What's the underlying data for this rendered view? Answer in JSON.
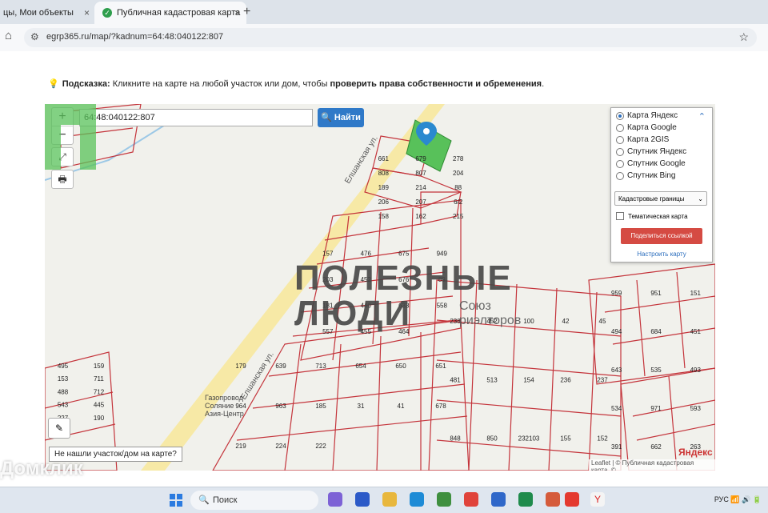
{
  "browser": {
    "tabs": [
      {
        "label": "цы, Мои объекты",
        "close": "×"
      },
      {
        "label": "Публичная кадастровая карта",
        "close": "×"
      }
    ],
    "new_tab": "+",
    "url": "egrp365.ru/map/?kadnum=64:48:040122:807"
  },
  "hint": {
    "prefix": "Подсказка:",
    "text": "Кликните на карте на любой участок или дом, чтобы",
    "bold": "проверить права собственности и обременения",
    "suffix": "."
  },
  "map": {
    "search_value": "64:48:040122:807",
    "find_label": "Найти",
    "zoom_in": "+",
    "zoom_out": "−",
    "layers": [
      {
        "label": "Карта Яндекс",
        "selected": true
      },
      {
        "label": "Карта Google",
        "selected": false
      },
      {
        "label": "Карта 2GIS",
        "selected": false
      },
      {
        "label": "Спутник Яндекс",
        "selected": false
      },
      {
        "label": "Спутник Google",
        "selected": false
      },
      {
        "label": "Спутник Bing",
        "selected": false
      }
    ],
    "layer_select": "Кадастровые границы",
    "thematic_label": "Тематическая карта",
    "share_label": "Поделиться ссылкой",
    "setup_label": "Настроить карту",
    "not_found": "Не нашли участок/дом на карте?",
    "yandex": "Яндекс",
    "attribution": "Leaflet | © Публичная кадастровая карта, ©",
    "street1": "Елшанская ул.",
    "street2": "Елшанская ул.",
    "gas_label1": "Газопровод",
    "gas_label2": "Соляние",
    "gas_label3": "Азия-Центр",
    "parcels": [
      "661",
      "679",
      "278",
      "808",
      "807",
      "204",
      "189",
      "214",
      "88",
      "206",
      "207",
      "6/2",
      "158",
      "162",
      "215",
      "157",
      "476",
      "675",
      "949",
      "203",
      "452",
      "676",
      "89",
      "181",
      "440",
      "633",
      "558",
      "557",
      "455",
      "464",
      "179",
      "639",
      "713",
      "654",
      "650",
      "651",
      "964",
      "963",
      "185",
      "31",
      "41",
      "678",
      "219",
      "224",
      "222",
      "238",
      "452",
      "100",
      "42",
      "45",
      "481",
      "513",
      "154",
      "236",
      "237",
      "848",
      "850",
      "232103",
      "155",
      "152",
      "959",
      "951",
      "151",
      "494",
      "684",
      "451",
      "643",
      "535",
      "493",
      "534",
      "971",
      "593",
      "391",
      "662",
      "263",
      "495",
      "159",
      "153",
      "711",
      "488",
      "712",
      "543",
      "445",
      "227",
      "190",
      "164"
    ]
  },
  "watermark": {
    "line1": "ПОЛЕЗНЫЕ",
    "line2": "ЛЮДИ",
    "line3": "Союз",
    "line4": "риэлторов",
    "overlay": "Домклик"
  },
  "taskbar": {
    "search_label": "Поиск",
    "lang": "РУС"
  },
  "colors": {
    "parcel_line": "#c4343b",
    "highlight": "#58c15a",
    "accent": "#2f79c8"
  }
}
